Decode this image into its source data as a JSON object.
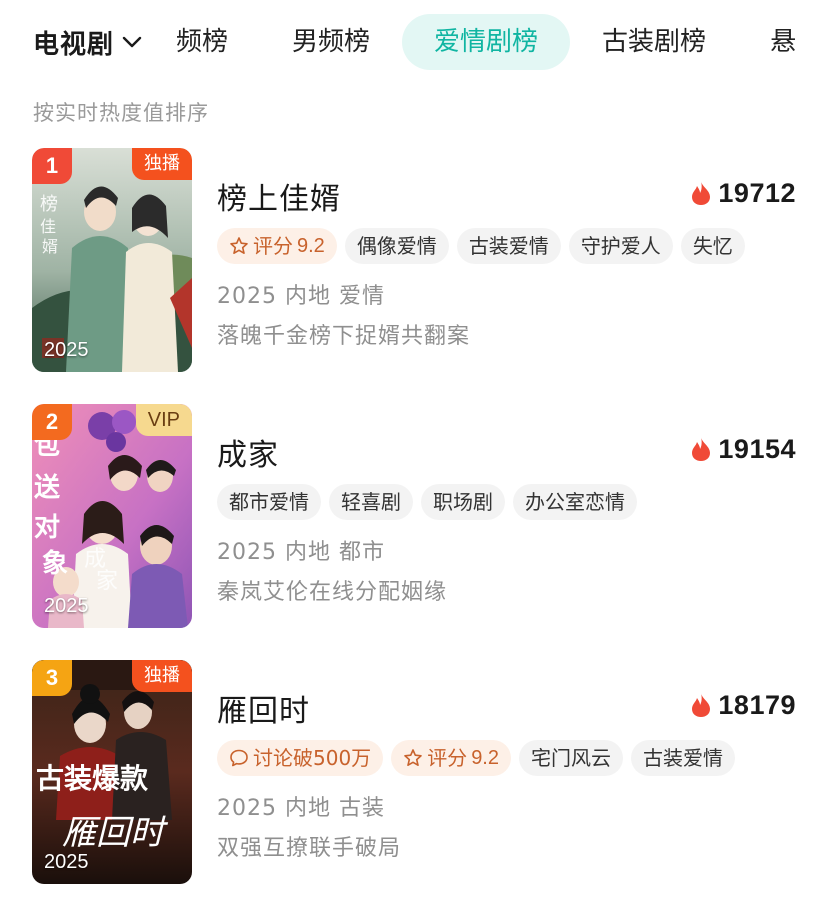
{
  "category": {
    "label": "电视剧"
  },
  "tabs": [
    {
      "label": "频榜"
    },
    {
      "label": "男频榜"
    },
    {
      "label": "爱情剧榜"
    },
    {
      "label": "古装剧榜"
    },
    {
      "label": "悬"
    }
  ],
  "sort_hint": "按实时热度值排序",
  "colors": {
    "accent": "#10b5a2",
    "accent_bg": "#e3f7f4",
    "heat": "#f04a37"
  },
  "items": [
    {
      "rank": "1",
      "badge": "独播",
      "poster_year": "2025",
      "title": "榜上佳婿",
      "heat": "19712",
      "rating": {
        "label": "评分",
        "value": "9.2"
      },
      "tags": [
        "偶像爱情",
        "古装爱情",
        "守护爱人",
        "失忆"
      ],
      "meta": "2025 内地 爱情",
      "desc": "落魄千金榜下捉婿共翻案"
    },
    {
      "rank": "2",
      "badge": "VIP",
      "poster_year": "2025",
      "title": "成家",
      "heat": "19154",
      "tags": [
        "都市爱情",
        "轻喜剧",
        "职场剧",
        "办公室恋情"
      ],
      "meta": "2025 内地 都市",
      "desc": "秦岚艾伦在线分配姻缘"
    },
    {
      "rank": "3",
      "badge": "独播",
      "poster_year": "2025",
      "title": "雁回时",
      "heat": "18179",
      "discussion": "讨论破500万",
      "rating": {
        "label": "评分",
        "value": "9.2"
      },
      "tags": [
        "宅门风云",
        "古装爱情"
      ],
      "meta": "2025 内地 古装",
      "desc": "双强互撩联手破局"
    }
  ]
}
